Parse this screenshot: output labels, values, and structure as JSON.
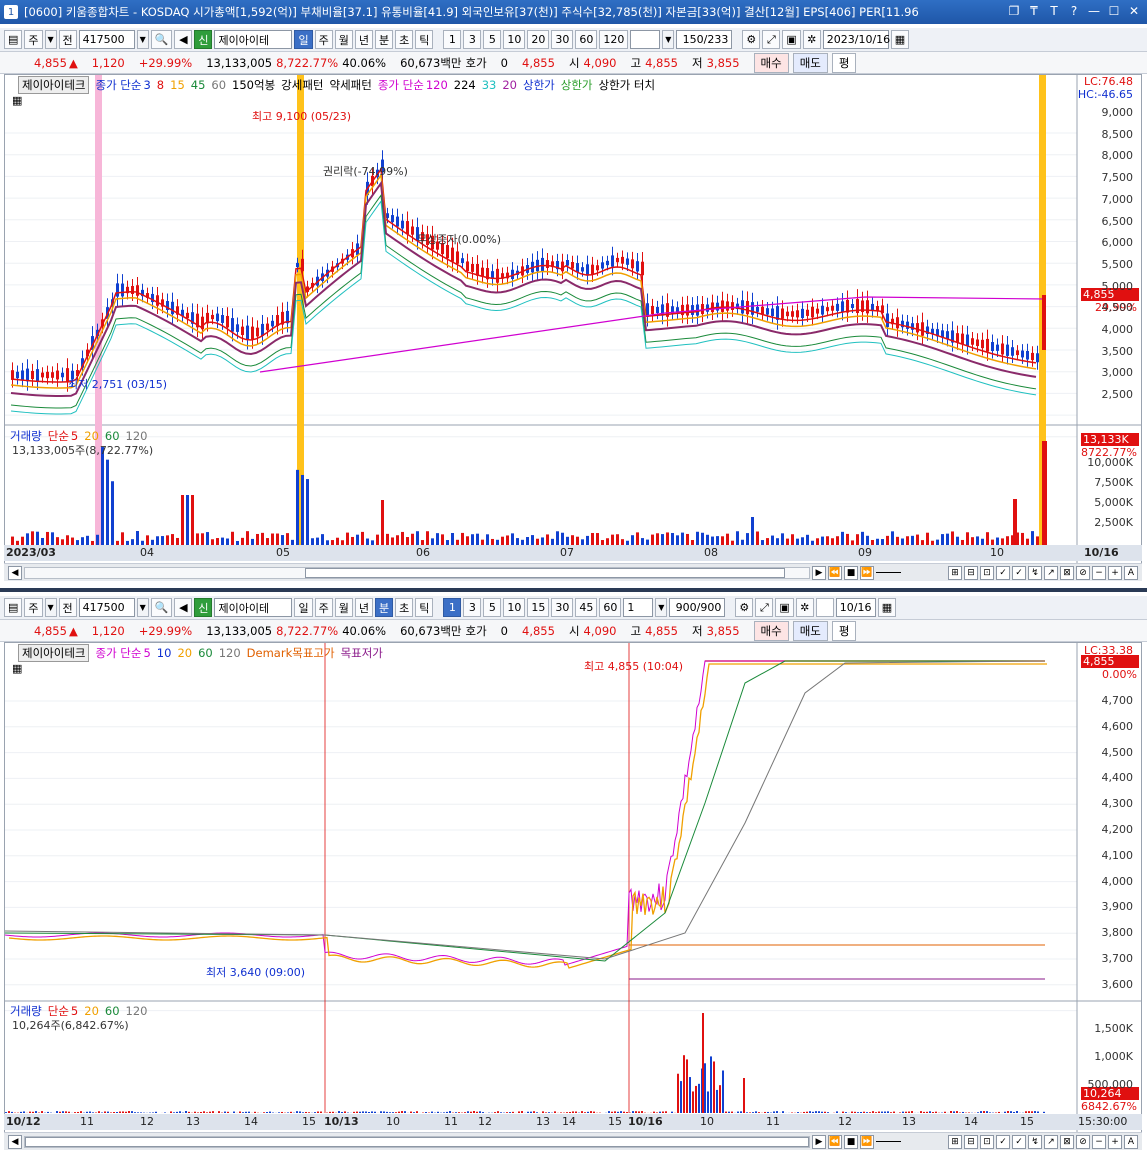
{
  "window": {
    "title_num": "1",
    "title": "[0600] 키움종합차트 - KOSDAQ 시가총액[1,592(억)] 부채비율[37.1] 유통비율[41.9] 외국인보유[37(천)] 주식수[32,785(천)] 자본금[33(억)] 결산[12월] EPS[406] PER[11.96"
  },
  "top": {
    "toolbar": {
      "period_select": "주",
      "btn_prev": "전",
      "code": "417500",
      "badge": "신",
      "name": "제이아이테",
      "tabs": [
        "일",
        "주",
        "월",
        "년",
        "분",
        "초",
        "틱"
      ],
      "active_tab": "일",
      "nums": [
        "1",
        "3",
        "5",
        "10",
        "20",
        "30",
        "60",
        "120"
      ],
      "count": "150/233",
      "date": "2023/10/16"
    },
    "quote": {
      "price": "4,855",
      "change": "1,120",
      "rate": "+29.99%",
      "volume": "13,133,005",
      "vol_ratio": "8,722.77%",
      "turnover_rate": "40.06%",
      "amount": "60,673백만",
      "hoga_label": "호가",
      "hoga_val": "0",
      "hoga_price": "4,855",
      "open_label": "시",
      "open": "4,090",
      "high_label": "고",
      "high": "4,855",
      "low_label": "저",
      "low": "3,855",
      "buy": "매수",
      "sell": "매도",
      "avg": "평"
    },
    "legend": {
      "name": "제이아이테크",
      "ma_label": "종가 단순",
      "ma_periods": [
        "3",
        "8",
        "15",
        "45",
        "60"
      ],
      "ind1": "150억봉",
      "ind2": "강세패턴",
      "ind3": "약세패턴",
      "ma2_label": "종가 단순",
      "ma2_periods": [
        "120",
        "224",
        "33",
        "20"
      ],
      "limit_up": "상한가",
      "limit_up2": "상한가",
      "limit_touch": "상한가 터치"
    },
    "annotations": {
      "high": "최고 9,100 (05/23)",
      "rights": "권리락(-74.99%)",
      "bonus": "무상증자(0.00%)",
      "low": "최저 2,751 (03/15)"
    },
    "right_labels": {
      "lc": "LC:76.48",
      "hc": "HC:-46.65",
      "price_tag": "4,855",
      "price_pct": "29.99%"
    },
    "y_ticks": [
      "9,000",
      "8,500",
      "8,000",
      "7,500",
      "7,000",
      "6,500",
      "6,000",
      "5,500",
      "5,000",
      "4,500",
      "4,000",
      "3,500",
      "3,000",
      "2,500"
    ],
    "volume_legend": {
      "label": "거래량",
      "ma_label": "단순",
      "periods": [
        "5",
        "20",
        "60",
        "120"
      ],
      "summary": "13,133,005주(8,722.77%)",
      "tag": "13,133K",
      "tag_pct": "8722.77%"
    },
    "vol_ticks": [
      "10,000K",
      "7,500K",
      "5,000K",
      "2,500K"
    ],
    "x_labels": [
      "2023/03",
      "04",
      "05",
      "06",
      "07",
      "08",
      "09",
      "10",
      "10/16"
    ]
  },
  "bottom": {
    "toolbar": {
      "period_select": "주",
      "btn_prev": "전",
      "code": "417500",
      "badge": "신",
      "name": "제이아이테",
      "tabs": [
        "일",
        "주",
        "월",
        "년",
        "분",
        "초",
        "틱"
      ],
      "active_tab": "분",
      "nums": [
        "1",
        "3",
        "5",
        "10",
        "15",
        "30",
        "45",
        "60"
      ],
      "min_val": "1",
      "count": "900/900",
      "date": "10/16"
    },
    "quote": {
      "price": "4,855",
      "change": "1,120",
      "rate": "+29.99%",
      "volume": "13,133,005",
      "vol_ratio": "8,722.77%",
      "turnover_rate": "40.06%",
      "amount": "60,673백만",
      "hoga_label": "호가",
      "hoga_val": "0",
      "hoga_price": "4,855",
      "open_label": "시",
      "open": "4,090",
      "high_label": "고",
      "high": "4,855",
      "low_label": "저",
      "low": "3,855",
      "buy": "매수",
      "sell": "매도",
      "avg": "평"
    },
    "legend": {
      "name": "제이아이테크",
      "ma_label": "종가 단순",
      "ma_periods": [
        "5",
        "10",
        "20",
        "60",
        "120"
      ],
      "demark": "Demark목표고가",
      "demark_low": "목표저가"
    },
    "annotations": {
      "high": "최고 4,855 (10:04)",
      "low": "최저 3,640 (09:00)"
    },
    "right_labels": {
      "lc": "LC:33.38",
      "price_tag": "4,855",
      "price_pct": "0.00%"
    },
    "y_ticks": [
      "4,700",
      "4,600",
      "4,500",
      "4,400",
      "4,300",
      "4,200",
      "4,100",
      "4,000",
      "3,900",
      "3,800",
      "3,700",
      "3,600"
    ],
    "volume_legend": {
      "label": "거래량",
      "ma_label": "단순",
      "periods": [
        "5",
        "20",
        "60",
        "120"
      ],
      "summary": "10,264주(6,842.67%)",
      "tag": "10,264",
      "tag_pct": "6842.67%"
    },
    "vol_ticks": [
      "1,500K",
      "1,000K",
      "500,000"
    ],
    "x_labels": [
      "10/12",
      "11",
      "12",
      "13",
      "14",
      "15",
      "10/13",
      "10",
      "11",
      "12",
      "13",
      "14",
      "15",
      "10/16",
      "10",
      "11",
      "12",
      "13",
      "14",
      "15",
      "15:30:00"
    ]
  }
}
